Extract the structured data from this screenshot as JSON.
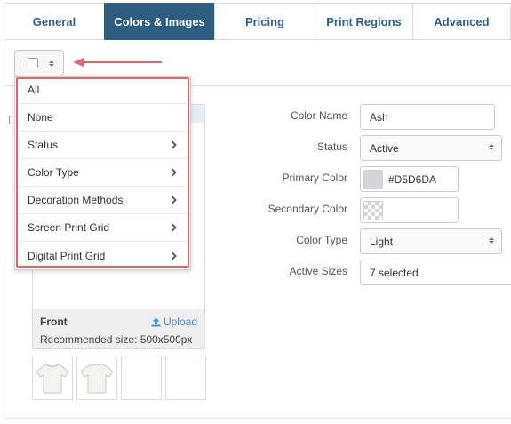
{
  "tabs": [
    {
      "label": "General",
      "active": false
    },
    {
      "label": "Colors & Images",
      "active": true
    },
    {
      "label": "Pricing",
      "active": false
    },
    {
      "label": "Print Regions",
      "active": false
    },
    {
      "label": "Advanced",
      "active": false
    }
  ],
  "select_menu": {
    "items": [
      {
        "label": "All",
        "submenu": false
      },
      {
        "label": "None",
        "submenu": false
      },
      {
        "label": "Status",
        "submenu": true
      },
      {
        "label": "Color Type",
        "submenu": true
      },
      {
        "label": "Decoration Methods",
        "submenu": true
      },
      {
        "label": "Screen Print Grid",
        "submenu": true
      },
      {
        "label": "Digital Print Grid",
        "submenu": true
      }
    ]
  },
  "image_panel": {
    "view_label": "Front",
    "upload_label": "Upload",
    "recommended": "Recommended size: 500x500px"
  },
  "form": {
    "color_name": {
      "label": "Color Name",
      "value": "Ash"
    },
    "status": {
      "label": "Status",
      "value": "Active"
    },
    "primary_color": {
      "label": "Primary Color",
      "value": "#D5D6DA"
    },
    "secondary_color": {
      "label": "Secondary Color",
      "value": ""
    },
    "color_type": {
      "label": "Color Type",
      "value": "Light"
    },
    "active_sizes": {
      "label": "Active Sizes",
      "value": "7 selected"
    }
  },
  "colors": {
    "tab_active_bg": "#2c5d80",
    "tab_text": "#2e5f86",
    "highlight": "#e8636a",
    "primary_swatch": "#d5d6da",
    "link": "#4a90c8"
  },
  "icons": [
    "checkbox-icon",
    "caret-updown-icon",
    "chevron-right-icon",
    "upload-icon",
    "tshirt-icon",
    "checkerboard-icon"
  ]
}
